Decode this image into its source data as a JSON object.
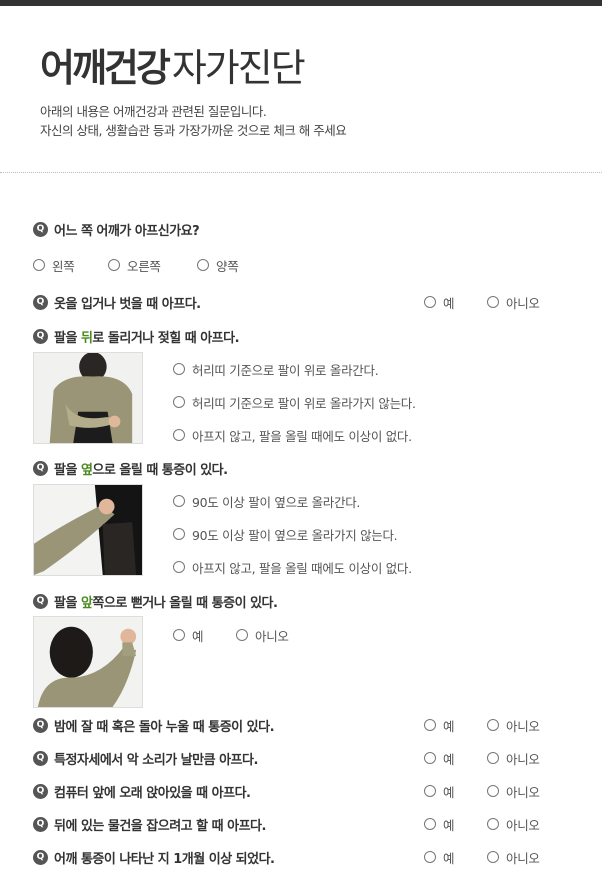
{
  "header": {
    "title_bold": "어깨건강",
    "title_light": "자가진단",
    "desc_line1": "아래의 내용은 어깨건강과 관련된 질문입니다.",
    "desc_line2": "자신의 상태, 생활습관 등과 가장가까운 것으로 체크 해 주세요"
  },
  "q_icon": "Q",
  "q1": {
    "text": "어느 쪽 어깨가 아프신가요?",
    "options": [
      "왼쪽",
      "오른쪽",
      "양쪽"
    ]
  },
  "q2": {
    "text": "옷을 입거나 벗을 때 아프다."
  },
  "q3": {
    "pre": "팔을 ",
    "hl": "뒤",
    "post": "로 돌리거나 젖힐 때 아프다.",
    "options": [
      "허리띠 기준으로 팔이 위로 올라간다.",
      "허리띠 기준으로 팔이 위로 올라가지 않는다.",
      "아프지 않고, 팔을 올릴 때에도 이상이 없다."
    ]
  },
  "q4": {
    "pre": "팔을 ",
    "hl": "옆",
    "post": "으로 올릴 때 통증이 있다.",
    "options": [
      "90도 이상 팔이 옆으로 올라간다.",
      "90도 이상 팔이 옆으로 올라가지 않는다.",
      "아프지 않고, 팔을 올릴 때에도 이상이 없다."
    ]
  },
  "q5": {
    "pre": "팔을 ",
    "hl": "앞",
    "post": "쪽으로 뻗거나 올릴 때 통증이 있다."
  },
  "q6": {
    "text": "밤에 잘 때 혹은 돌아 누울 때 통증이 있다."
  },
  "q7": {
    "text": "특정자세에서 악 소리가 날만큼 아프다."
  },
  "q8": {
    "text": "컴퓨터 앞에 오래 앉아있을 때 아프다."
  },
  "q9": {
    "text": "뒤에 있는 물건을 잡으려고 할 때 아프다."
  },
  "q10": {
    "text": "어깨 통증이 나타난 지 1개월 이상 되었다."
  },
  "yes": "예",
  "no": "아니오",
  "colors": {
    "accent_green": "#4a8a1f",
    "top_bar": "#333333",
    "q_icon_bg": "#555555"
  }
}
